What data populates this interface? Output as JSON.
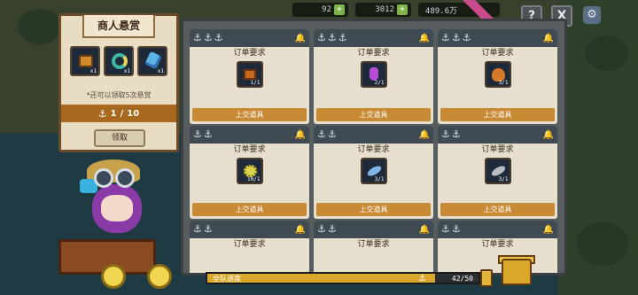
{
  "topbar": {
    "currency1": "92",
    "currency2": "3012",
    "currency3": "489.6万"
  },
  "header": {
    "help_label": "?",
    "close_label": "X"
  },
  "bounty": {
    "title": "商人悬赏",
    "rewards": [
      {
        "icon": "chest-icon",
        "qty": "x1"
      },
      {
        "icon": "ring-icon",
        "qty": "x1"
      },
      {
        "icon": "crystal-icon",
        "qty": "x1"
      }
    ],
    "note": "*还可以领取5次悬赏",
    "progress_current": "1",
    "progress_total": "10",
    "claim_label": "领取"
  },
  "orders": [
    {
      "label": "订单要求",
      "count": "1/1",
      "submit": "上交道具",
      "icon": "treasure-box-icon"
    },
    {
      "label": "订单要求",
      "count": "2/1",
      "submit": "上交道具",
      "icon": "potion-icon"
    },
    {
      "label": "订单要求",
      "count": "3/1",
      "submit": "上交道具",
      "icon": "bag-icon"
    },
    {
      "label": "订单要求",
      "count": "10/1",
      "submit": "上交道具",
      "icon": "pufferfish-icon"
    },
    {
      "label": "订单要求",
      "count": "3/1",
      "submit": "上交道具",
      "icon": "fish-icon"
    },
    {
      "label": "订单要求",
      "count": "3/1",
      "submit": "上交道具",
      "icon": "fish-icon"
    },
    {
      "label": "订单要求"
    },
    {
      "label": "订单要求"
    },
    {
      "label": "订单要求"
    }
  ],
  "team": {
    "label": "全队进度",
    "current": 42,
    "total": 50,
    "count_text": "42/50"
  },
  "colors": {
    "accent": "#c98a36",
    "progress": "#d9a82a"
  }
}
